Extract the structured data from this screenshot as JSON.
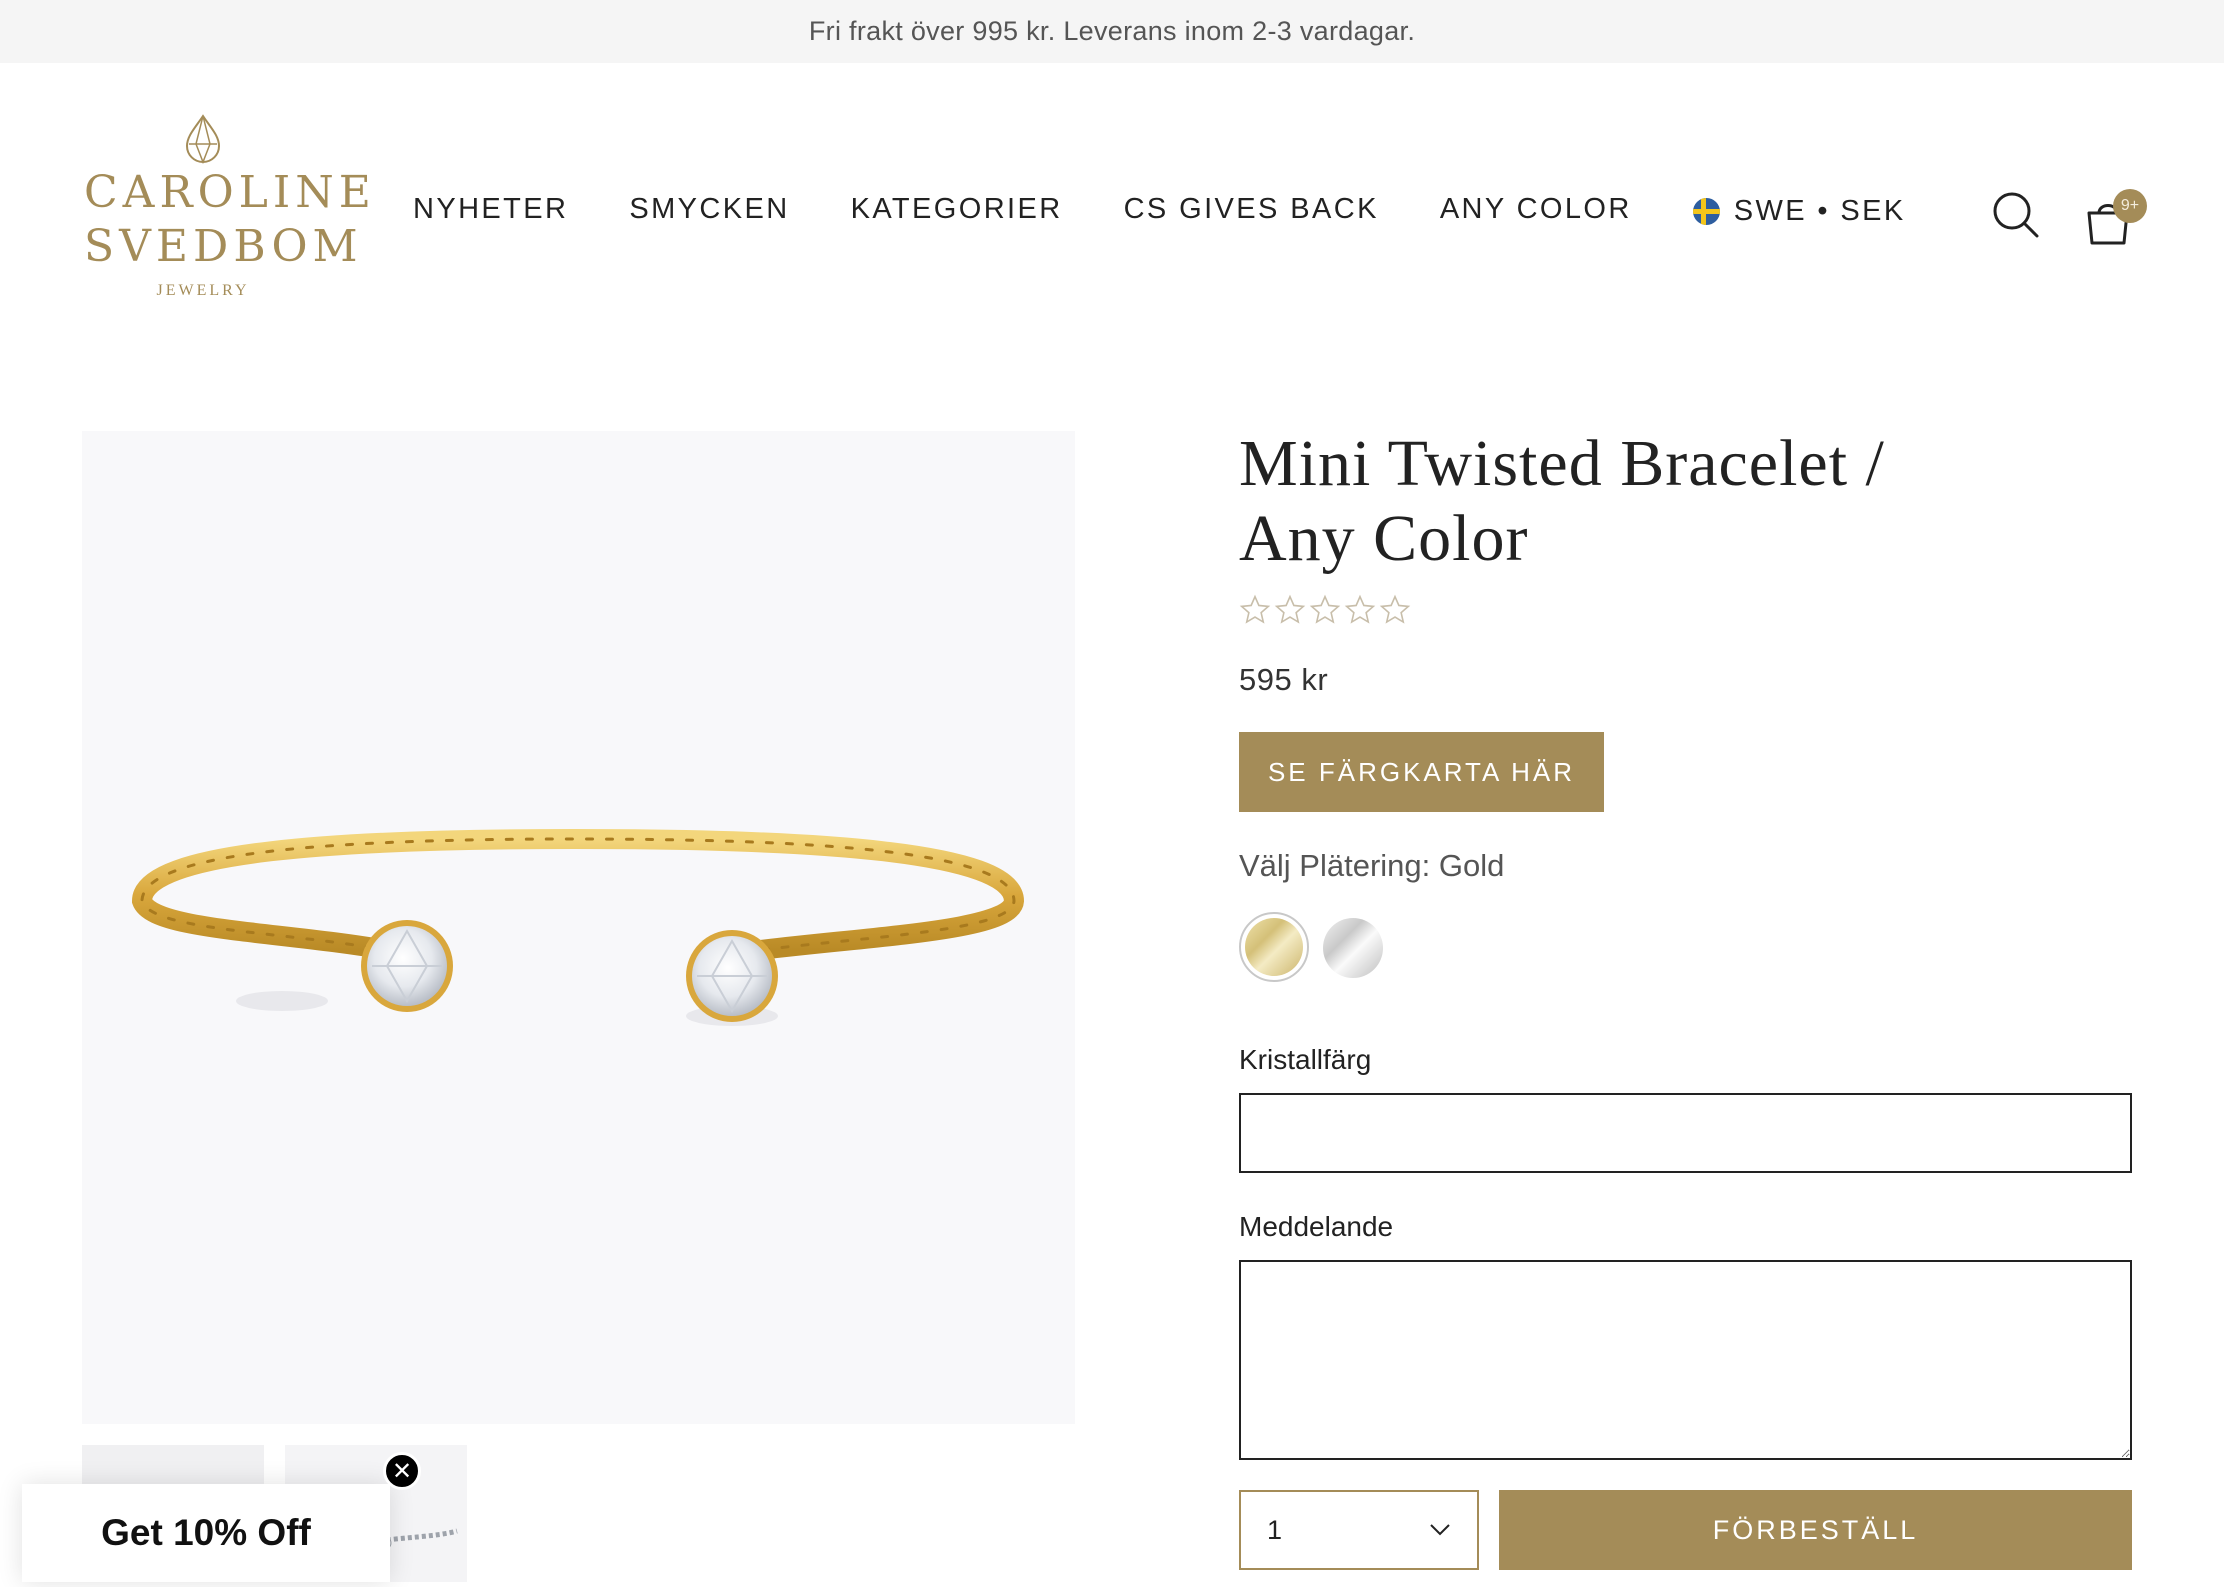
{
  "announcement": "Fri frakt över 995 kr. Leverans inom 2-3 vardagar.",
  "brand": {
    "line1": "CAROLINE",
    "line2": "SVEDBOM",
    "tagline": "JEWELRY",
    "color": "#a48c58"
  },
  "nav": {
    "items": [
      {
        "label": "NYHETER"
      },
      {
        "label": "SMYCKEN"
      },
      {
        "label": "KATEGORIER"
      },
      {
        "label": "CS GIVES BACK"
      },
      {
        "label": "ANY COLOR"
      }
    ],
    "locale": "SWE • SEK",
    "locale_flag": "sweden-flag-icon"
  },
  "header_icons": {
    "search": "search-icon",
    "cart": "shopping-bag-icon",
    "cart_count": "9+"
  },
  "product": {
    "title_line1": "Mini Twisted Bracelet /",
    "title_line2": "Any Color",
    "rating": 0,
    "rating_max": 5,
    "price": "595 kr",
    "color_chart_button": "SE FÄRGKARTA HÄR",
    "plating_label": "Välj Plätering: Gold",
    "plating_options": [
      "Gold",
      "Silver"
    ],
    "selected_plating": "Gold",
    "crystal_label": "Kristallfärg",
    "crystal_value": "",
    "message_label": "Meddelande",
    "message_value": "",
    "quantity": "1",
    "preorder_button": "FÖRBESTÄLL"
  },
  "promo": {
    "text": "Get 10% Off",
    "close": "close-icon"
  },
  "colors": {
    "accent": "#a48c58",
    "announce_bg": "#f5f5f5",
    "image_bg": "#f8f8fa"
  }
}
